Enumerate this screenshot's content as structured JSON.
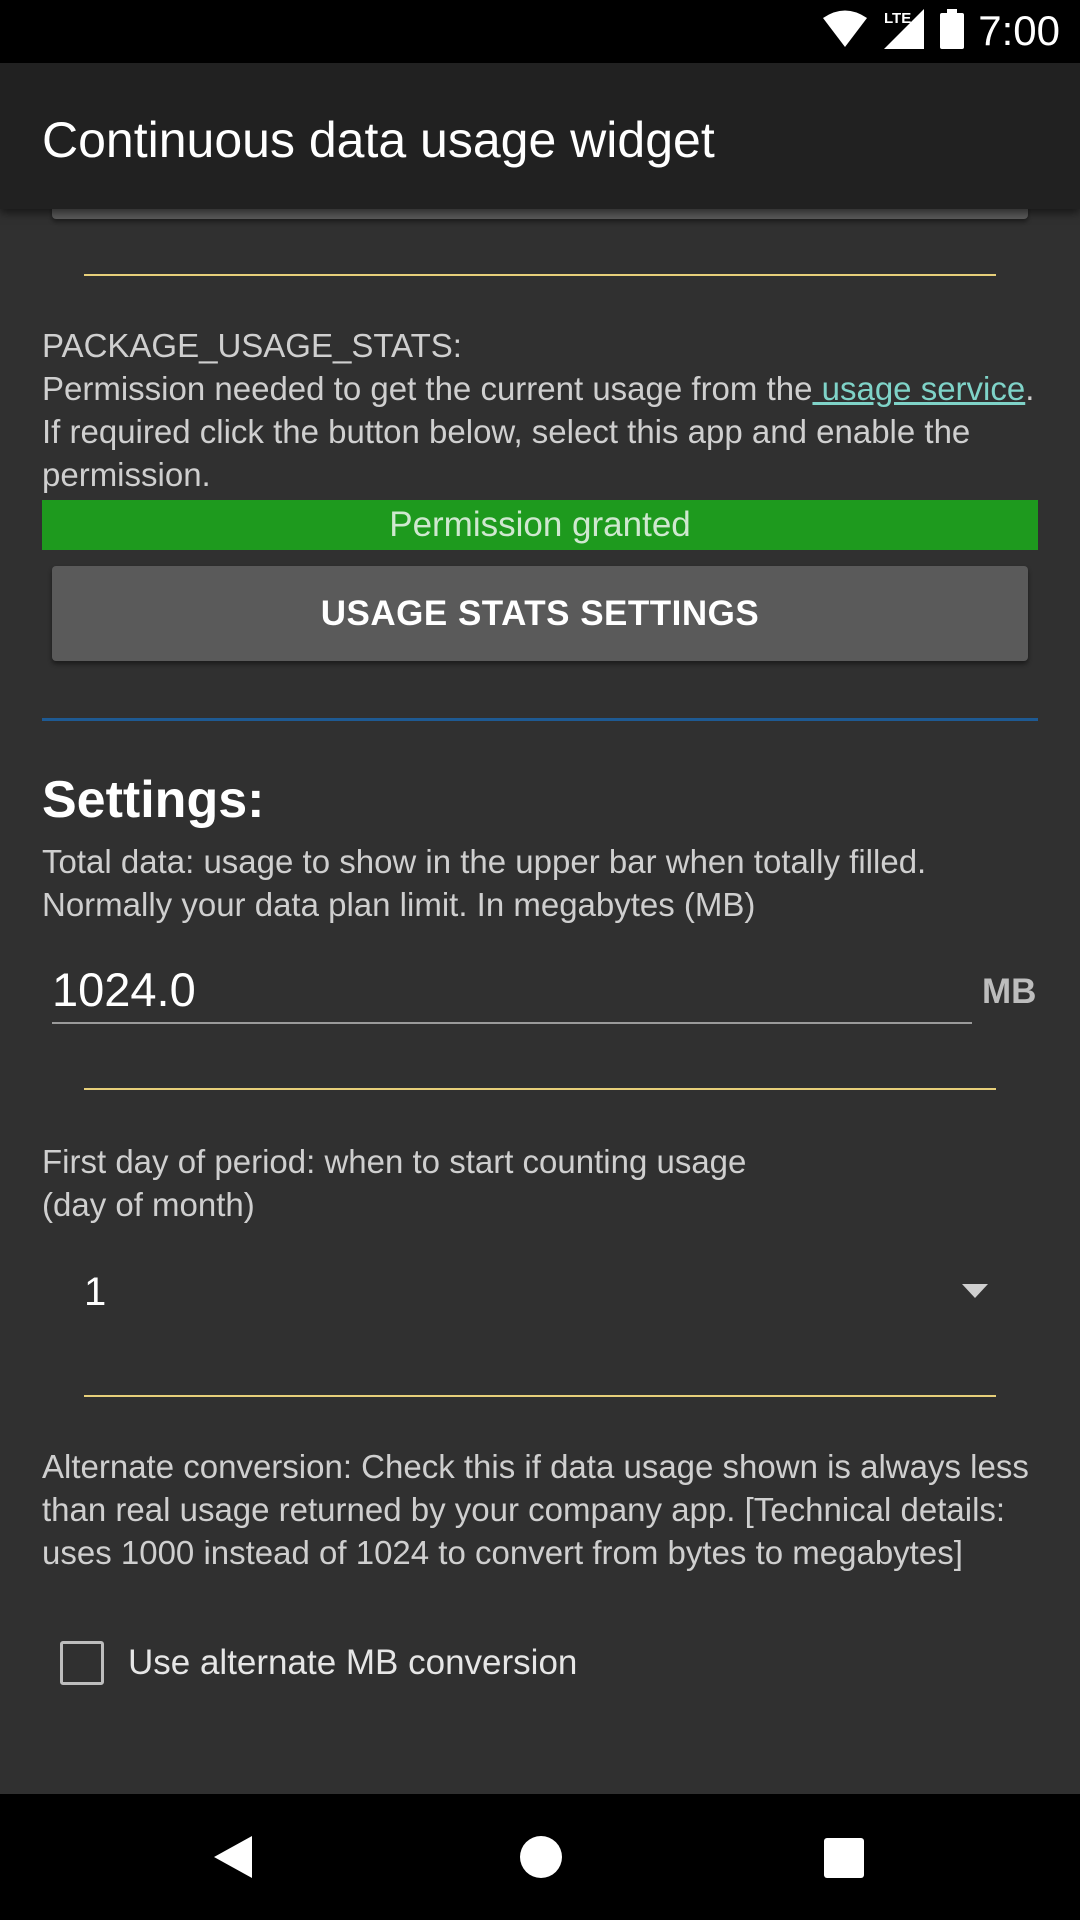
{
  "status_bar": {
    "time": "7:00",
    "network_label": "LTE"
  },
  "app_bar": {
    "title": "Continuous data usage widget"
  },
  "permission": {
    "name": "PACKAGE_USAGE_STATS:",
    "desc_before_link": "Permission needed to get the current usage from the",
    "link_text": " usage service",
    "desc_after_link": ". If required click the button below, select this app and enable the permission.",
    "status": "Permission granted",
    "status_color": "#1e9a1e",
    "button_label": "USAGE STATS SETTINGS"
  },
  "settings": {
    "heading": "Settings:",
    "total_data": {
      "description": "Total data: usage to show in the upper bar when totally filled. Normally your data plan limit. In megabytes (MB)",
      "value": "1024.0",
      "unit": "MB"
    },
    "first_day": {
      "description_line1": "First day of period: when to start counting usage",
      "description_line2": "(day of month)",
      "selected": "1"
    },
    "alternate_conversion": {
      "description": "Alternate conversion: Check this if data usage shown is always less than real usage returned by your company app. [Technical details: uses 1000 instead of 1024 to convert from bytes to megabytes]",
      "checkbox_label": "Use alternate MB conversion",
      "checked": false
    }
  },
  "colors": {
    "accent_yellow": "#e6cf7a",
    "divider_blue": "#1e5a93",
    "link": "#7fd3c8"
  }
}
